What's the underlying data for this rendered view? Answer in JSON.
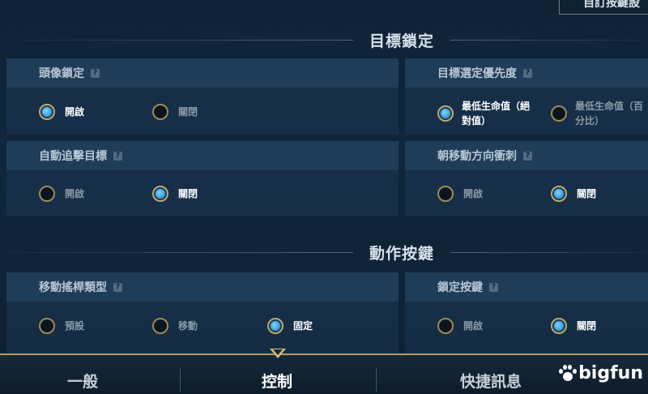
{
  "top_button": {
    "label": "自訂按鍵設"
  },
  "sections": {
    "target_lock": "目標鎖定",
    "action_keys": "動作按鍵"
  },
  "help_icon_glyph": "?",
  "panels": {
    "avatar_lock": {
      "title": "頭像鎖定",
      "options": [
        "開啟",
        "關閉"
      ],
      "selected": "開啟"
    },
    "target_priority": {
      "title": "目標選定優先度",
      "options": [
        "最低生命值（絕對值）",
        "最低生命值（百分比）"
      ],
      "option_lines": [
        [
          "最低生命值（絕",
          "對值）"
        ],
        [
          "最低生命值（百",
          "分比）"
        ]
      ],
      "selected": "最低生命值（絕對值）"
    },
    "auto_chase": {
      "title": "自動追擊目標",
      "options": [
        "開啟",
        "關閉"
      ],
      "selected": "關閉"
    },
    "dash_direction": {
      "title": "朝移動方向衝刺",
      "options": [
        "開啟",
        "關閉"
      ],
      "selected": "關閉"
    },
    "joystick_type": {
      "title": "移動搖桿類型",
      "options": [
        "預設",
        "移動",
        "固定"
      ],
      "selected": "固定"
    },
    "lock_key": {
      "title": "鎖定按鍵",
      "options": [
        "開啟",
        "關閉"
      ],
      "selected": "關閉"
    }
  },
  "tabs": [
    {
      "label": "一般",
      "active": false
    },
    {
      "label": "控制",
      "active": true
    },
    {
      "label": "快捷訊息",
      "active": false
    }
  ],
  "watermark": "bigfun",
  "colors": {
    "accent_gold": "#c9a86a",
    "radio_active": "#3cb3ff",
    "background": "#11263b"
  }
}
